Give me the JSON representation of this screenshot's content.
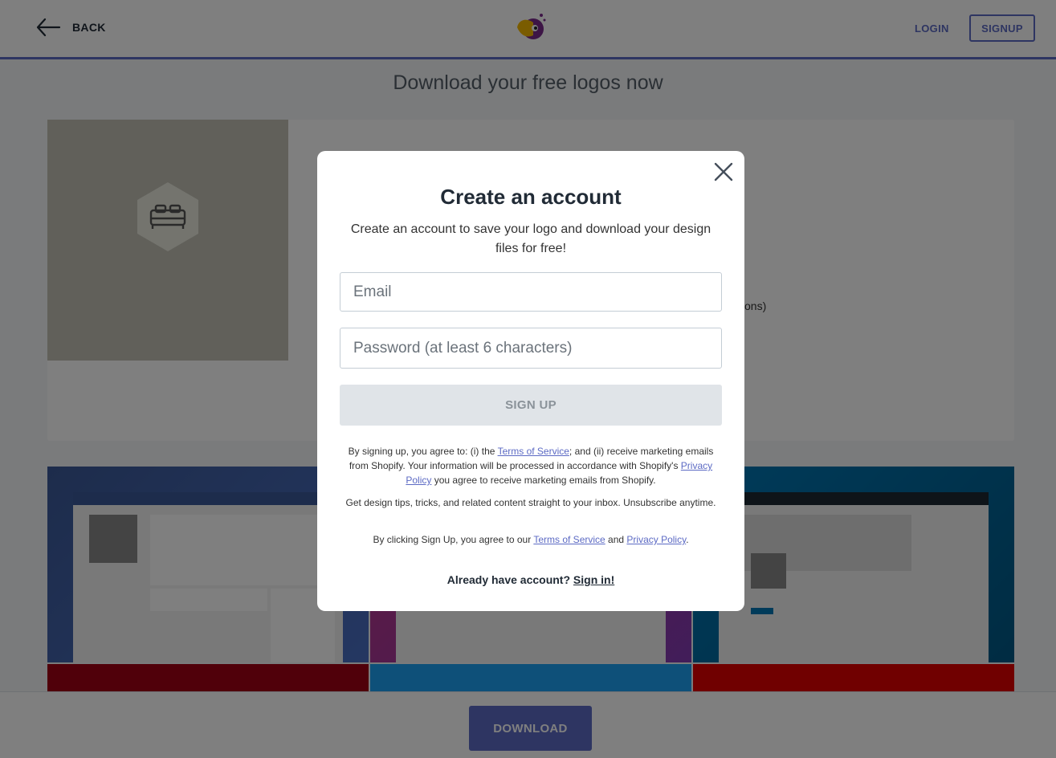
{
  "header": {
    "back_label": "BACK",
    "login_label": "LOGIN",
    "signup_label": "SIGNUP"
  },
  "page": {
    "title": "Download your free logos now",
    "card_partial_text": "ons)"
  },
  "footer": {
    "download_label": "DOWNLOAD"
  },
  "modal": {
    "title": "Create an account",
    "subtitle": "Create an account to save your logo and download your design files for free!",
    "email_placeholder": "Email",
    "password_placeholder": "Password (at least 6 characters)",
    "signup_button": "SIGN UP",
    "legal1_pre": "By signing up, you agree to: (i) the ",
    "legal1_tos": "Terms of Service",
    "legal1_mid": "; and (ii) receive marketing emails from Shopify. Your information will be processed in accordance with Shopify's ",
    "legal1_privacy": "Privacy Policy",
    "legal1_post": " you agree to receive marketing emails from Shopify.",
    "legal2": "Get design tips, tricks, and related content straight to your inbox. Unsubscribe anytime.",
    "legal3_pre": "By clicking Sign Up, you agree to our ",
    "legal3_tos": "Terms of Service",
    "legal3_and": " and ",
    "legal3_privacy": "Privacy Policy",
    "legal3_post": ".",
    "already_text": "Already have account? ",
    "signin_link": "Sign in!"
  },
  "colors": {
    "accent": "#5c6ac4",
    "logo_placeholder": "#c2c1b5"
  },
  "icons": {
    "back": "arrow-left-icon",
    "brand": "parrot-logo-icon",
    "bed": "bed-icon",
    "close": "close-icon"
  }
}
